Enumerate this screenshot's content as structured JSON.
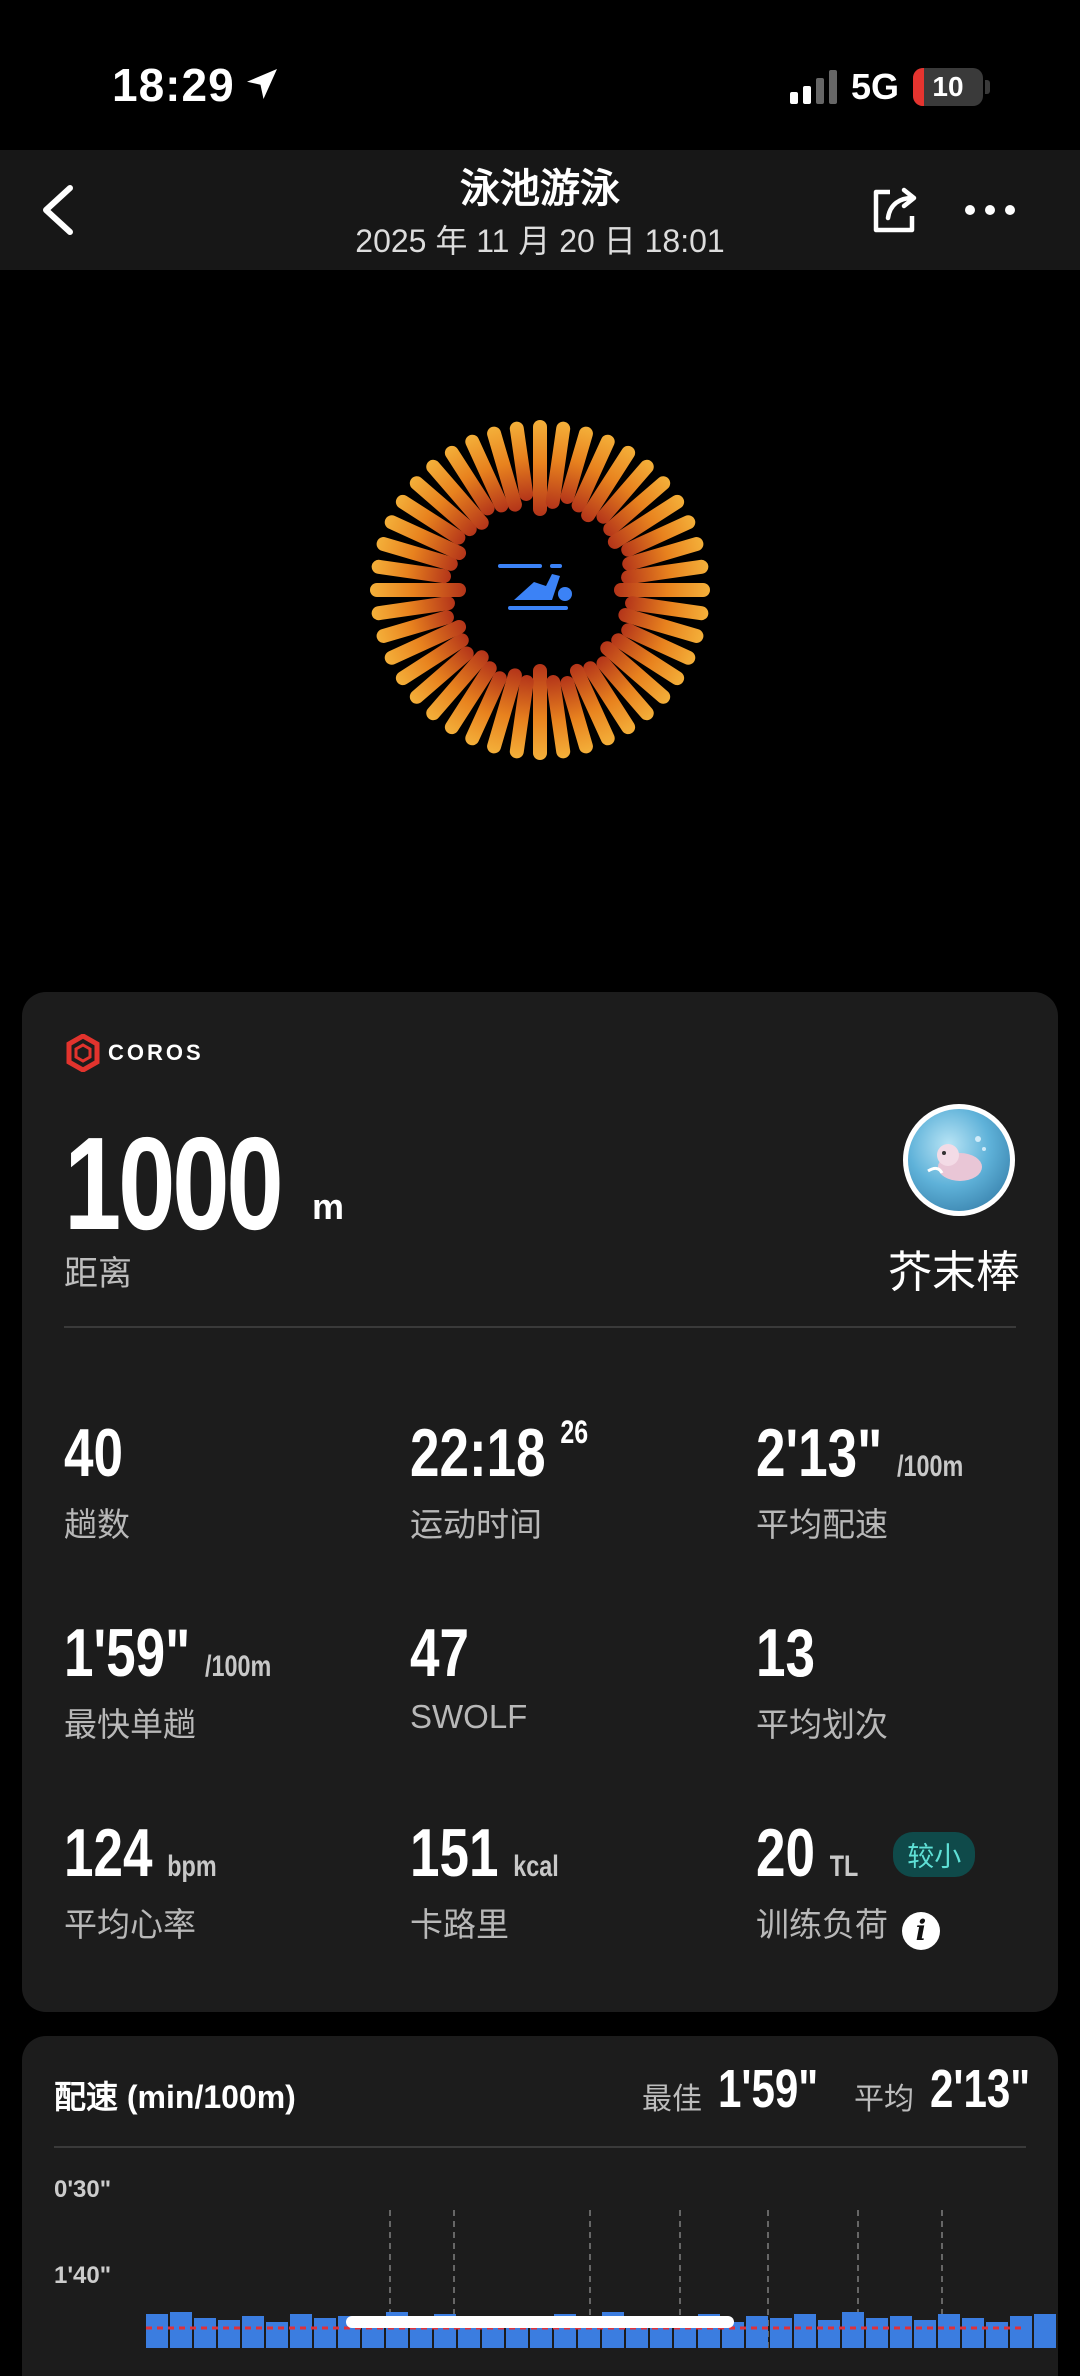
{
  "status_bar": {
    "time": "18:29",
    "network": "5G",
    "battery": "10"
  },
  "header": {
    "title": "泳池游泳",
    "subtitle": "2025 年 11 月 20 日 18:01"
  },
  "ring": {
    "icon": "swimmer-icon"
  },
  "summary": {
    "brand": "COROS",
    "distance_value": "1000",
    "distance_unit": "m",
    "distance_label": "距离",
    "user_name": "芥末棒",
    "metrics": [
      {
        "value": "40",
        "unit": "",
        "sup": "",
        "label": "趟数"
      },
      {
        "value": "22:18",
        "unit": "",
        "sup": "26",
        "label": "运动时间"
      },
      {
        "value": "2'13\"",
        "unit": "/100m",
        "sup": "",
        "label": "平均配速"
      },
      {
        "value": "1'59\"",
        "unit": "/100m",
        "sup": "",
        "label": "最快单趟"
      },
      {
        "value": "47",
        "unit": "",
        "sup": "",
        "label": "SWOLF"
      },
      {
        "value": "13",
        "unit": "",
        "sup": "",
        "label": "平均划次"
      },
      {
        "value": "124",
        "unit": "bpm",
        "sup": "",
        "label": "平均心率"
      },
      {
        "value": "151",
        "unit": "kcal",
        "sup": "",
        "label": "卡路里"
      },
      {
        "value": "20",
        "unit": "TL",
        "sup": "",
        "label": "训练负荷",
        "badge": "较小"
      }
    ]
  },
  "pace": {
    "title": "配速 (min/100m)",
    "best_label": "最佳",
    "best_value": "1'59\"",
    "avg_label": "平均",
    "avg_value": "2'13\"",
    "chart_data": {
      "type": "bar",
      "title": "配速 (min/100m)",
      "y_ticks": [
        "0'30\"",
        "1'40\""
      ],
      "avg_line": "2'13\"",
      "colors": {
        "bar": "#3b7de0",
        "avg_line": "#e0313a"
      }
    }
  }
}
